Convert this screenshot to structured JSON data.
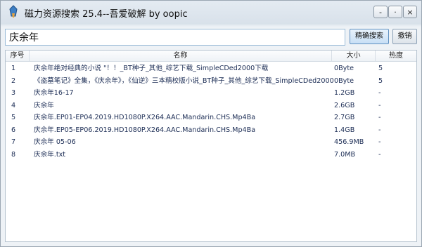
{
  "window": {
    "title": "磁力资源搜索 25.4--吾爱破解 by oopic",
    "controls": [
      "-",
      "·",
      "×"
    ]
  },
  "search": {
    "value": "庆余年",
    "search_button": "精确搜索",
    "cancel_button": "撤销"
  },
  "table": {
    "columns": [
      "序号",
      "名称",
      "大小",
      "热度"
    ],
    "rows": [
      {
        "no": "1",
        "name": "庆余年绝对经典的小说 \"！！_BT种子_其他_综艺下载_SimpleCDed2000下载",
        "size": "0Byte",
        "heat": "5"
      },
      {
        "no": "2",
        "name": "《盗墓笔记》全集，《庆余年》，《仙逆》三本精校版小说_BT种子_其他_综艺下载_SimpleCDed2000",
        "size": "0Byte",
        "heat": "5"
      },
      {
        "no": "3",
        "name": "庆余年16-17",
        "size": "1.2GB",
        "heat": "-"
      },
      {
        "no": "4",
        "name": "庆余年",
        "size": "2.6GB",
        "heat": "-"
      },
      {
        "no": "5",
        "name": "庆余年.EP01-EP04.2019.HD1080P.X264.AAC.Mandarin.CHS.Mp4Ba",
        "size": "2.7GB",
        "heat": "-"
      },
      {
        "no": "6",
        "name": "庆余年.EP05-EP06.2019.HD1080P.X264.AAC.Mandarin.CHS.Mp4Ba",
        "size": "1.4GB",
        "heat": "-"
      },
      {
        "no": "7",
        "name": "庆余年 05-06",
        "size": "456.9MB",
        "heat": "-"
      },
      {
        "no": "8",
        "name": "庆余年.txt",
        "size": "7.0MB",
        "heat": "-"
      }
    ]
  }
}
